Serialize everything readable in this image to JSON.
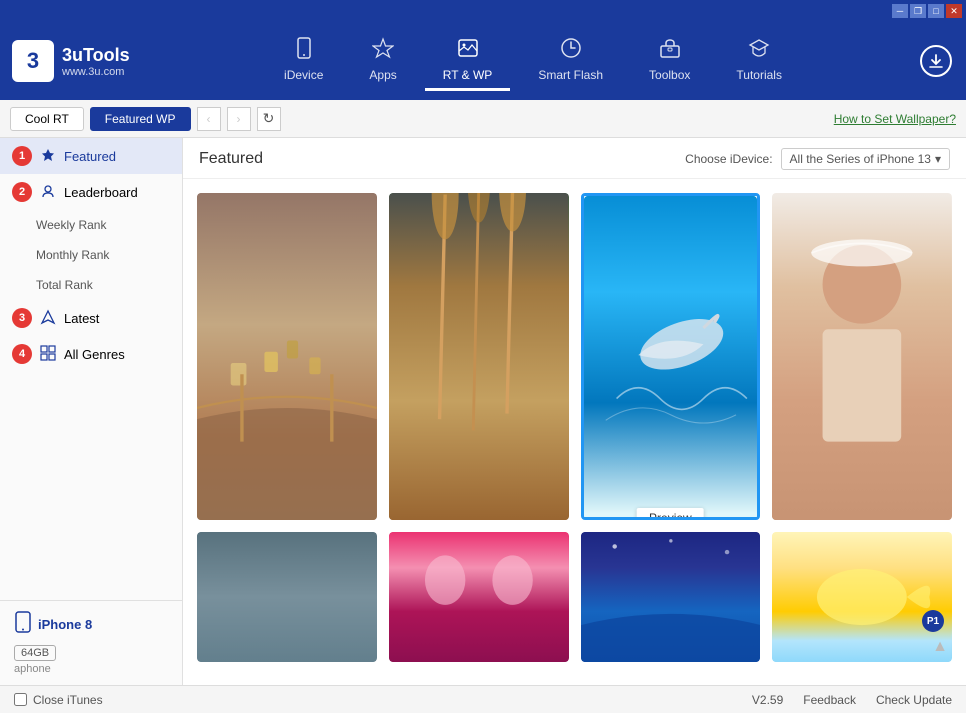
{
  "titleBar": {
    "controls": [
      "minimize",
      "maximize",
      "restore",
      "close"
    ]
  },
  "header": {
    "logo": {
      "icon": "3",
      "name": "3uTools",
      "url": "www.3u.com"
    },
    "navItems": [
      {
        "id": "idevice",
        "label": "iDevice",
        "icon": "📱",
        "active": false
      },
      {
        "id": "apps",
        "label": "Apps",
        "icon": "✦",
        "active": false
      },
      {
        "id": "rtwp",
        "label": "RT & WP",
        "icon": "🖼",
        "active": true
      },
      {
        "id": "smartflash",
        "label": "Smart Flash",
        "icon": "🔄",
        "active": false
      },
      {
        "id": "toolbox",
        "label": "Toolbox",
        "icon": "🧰",
        "active": false
      },
      {
        "id": "tutorials",
        "label": "Tutorials",
        "icon": "🎓",
        "active": false
      }
    ],
    "downloadIcon": "↓"
  },
  "toolbar": {
    "tabs": [
      {
        "id": "coolrt",
        "label": "Cool RT",
        "active": false
      },
      {
        "id": "featuredwp",
        "label": "Featured WP",
        "active": true
      }
    ],
    "backDisabled": true,
    "forwardDisabled": true,
    "howToLink": "How to Set Wallpaper?"
  },
  "sidebar": {
    "items": [
      {
        "id": "featured",
        "label": "Featured",
        "badge": "1",
        "icon": "⭐",
        "active": true,
        "level": 0
      },
      {
        "id": "leaderboard",
        "label": "Leaderboard",
        "badge": "2",
        "icon": "🏆",
        "active": false,
        "level": 0
      },
      {
        "id": "weekly-rank",
        "label": "Weekly Rank",
        "badge": null,
        "icon": null,
        "active": false,
        "level": 1
      },
      {
        "id": "monthly-rank",
        "label": "Monthly Rank",
        "badge": null,
        "icon": null,
        "active": false,
        "level": 1
      },
      {
        "id": "total-rank",
        "label": "Total Rank",
        "badge": null,
        "icon": null,
        "active": false,
        "level": 1
      },
      {
        "id": "latest",
        "label": "Latest",
        "badge": "3",
        "icon": "✈",
        "active": false,
        "level": 0
      },
      {
        "id": "all-genres",
        "label": "All Genres",
        "badge": "4",
        "icon": "⊞",
        "active": false,
        "level": 0
      }
    ],
    "device": {
      "name": "iPhone 8",
      "storage": "64GB",
      "user": "aphone"
    }
  },
  "content": {
    "title": "Featured",
    "deviceSelectLabel": "Choose iDevice:",
    "deviceSelectValue": "All the Series of iPhone 13",
    "images": [
      {
        "id": "img1",
        "colorClass": "img-locks",
        "highlighted": false,
        "preview": false,
        "tall": true,
        "p1": false
      },
      {
        "id": "img2",
        "colorClass": "img-reeds",
        "highlighted": false,
        "preview": false,
        "tall": true,
        "p1": false
      },
      {
        "id": "img3",
        "colorClass": "img-dolphin",
        "highlighted": true,
        "preview": true,
        "tall": true,
        "p1": false
      },
      {
        "id": "img4",
        "colorClass": "img-child",
        "highlighted": false,
        "preview": false,
        "tall": true,
        "p1": false
      },
      {
        "id": "img5",
        "colorClass": "img-sky",
        "highlighted": false,
        "preview": false,
        "tall": false,
        "p1": false
      },
      {
        "id": "img6",
        "colorClass": "img-drama",
        "highlighted": false,
        "preview": false,
        "tall": false,
        "p1": false
      },
      {
        "id": "img7",
        "colorClass": "img-night",
        "highlighted": false,
        "preview": false,
        "tall": false,
        "p1": false
      },
      {
        "id": "img8",
        "colorClass": "img-fish",
        "highlighted": false,
        "preview": false,
        "tall": false,
        "p1": true
      }
    ],
    "previewLabel": "Preview"
  },
  "statusBar": {
    "closeItunes": "Close iTunes",
    "version": "V2.59",
    "feedback": "Feedback",
    "checkUpdate": "Check Update"
  }
}
